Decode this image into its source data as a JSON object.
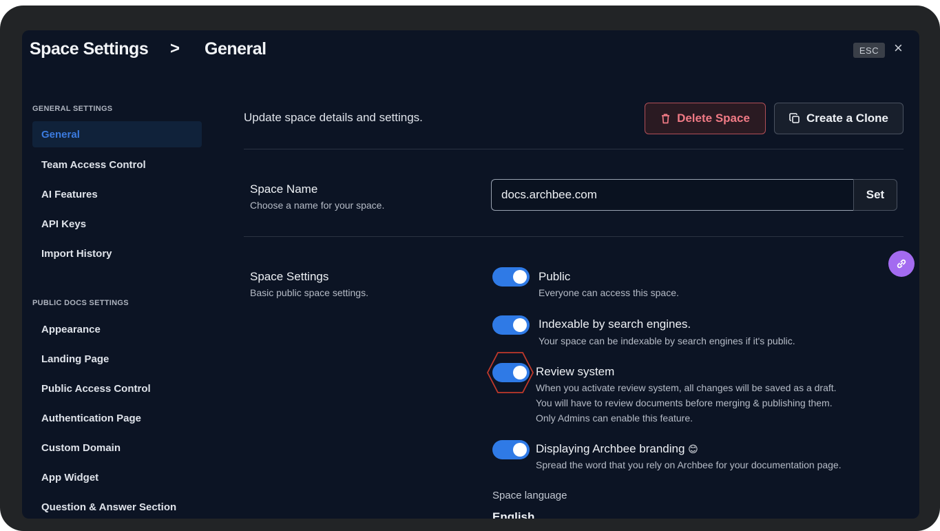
{
  "header": {
    "breadcrumb_root": "Space Settings",
    "breadcrumb_separator": ">",
    "breadcrumb_current": "General",
    "esc_label": "ESC",
    "close_label": "×"
  },
  "sidebar": {
    "general_section_title": "GENERAL SETTINGS",
    "general_items": [
      {
        "label": "General",
        "active": true
      },
      {
        "label": "Team Access Control"
      },
      {
        "label": "AI Features"
      },
      {
        "label": "API Keys"
      },
      {
        "label": "Import History"
      }
    ],
    "public_section_title": "PUBLIC DOCS SETTINGS",
    "public_items": [
      {
        "label": "Appearance"
      },
      {
        "label": "Landing Page"
      },
      {
        "label": "Public Access Control"
      },
      {
        "label": "Authentication Page"
      },
      {
        "label": "Custom Domain"
      },
      {
        "label": "App Widget"
      },
      {
        "label": "Question & Answer Section"
      }
    ]
  },
  "main": {
    "subtitle": "Update space details and settings.",
    "delete_label": "Delete Space",
    "clone_label": "Create a Clone",
    "space_name": {
      "title": "Space Name",
      "description": "Choose a name for your space.",
      "value": "docs.archbee.com",
      "set_label": "Set"
    },
    "space_settings": {
      "title": "Space Settings",
      "description": "Basic public space settings.",
      "options": [
        {
          "title": "Public",
          "description": "Everyone can access this space.",
          "enabled": true
        },
        {
          "title": "Indexable by search engines.",
          "description": "Your space can be indexable by search engines if it's public.",
          "enabled": true
        },
        {
          "title": "Review system",
          "description_lines": [
            "When you activate review system, all changes will be saved as a draft.",
            "You will have to review documents before merging & publishing them.",
            "Only Admins can enable this feature."
          ],
          "enabled": true
        },
        {
          "title": "Displaying Archbee branding",
          "emoji": "😊",
          "description": "Spread the word that you rely on Archbee for your documentation page.",
          "enabled": true
        }
      ]
    },
    "language": {
      "label": "Space language",
      "value": "English"
    }
  },
  "colors": {
    "accent_blue": "#2f7ae6",
    "danger": "#f07a85",
    "fab_purple": "#a36bf0",
    "highlight_red": "#c0392b"
  }
}
